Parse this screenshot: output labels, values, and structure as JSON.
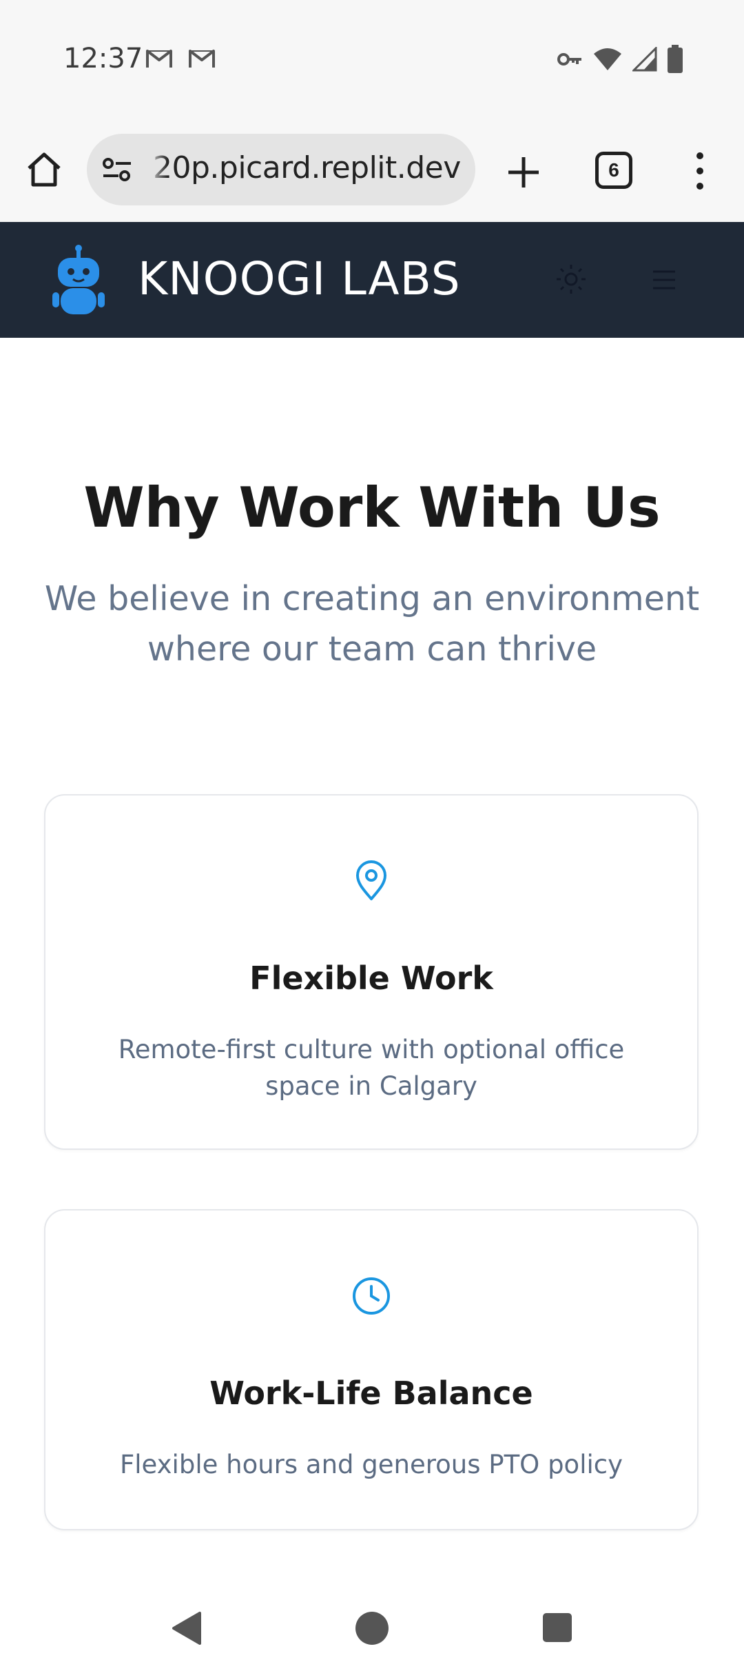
{
  "status_bar": {
    "time": "12:37",
    "left_icons": [
      "gmail-icon",
      "gmail-icon"
    ],
    "right_icons": [
      "vpn-key-icon",
      "wifi-icon",
      "cell-signal-icon",
      "battery-icon"
    ]
  },
  "browser": {
    "url": "20p.picard.replit.dev",
    "tab_count": "6",
    "icons": [
      "home-icon",
      "site-settings-icon",
      "plus-icon",
      "more-vert-icon"
    ]
  },
  "header": {
    "brand": "KNOOGI LABS",
    "brand_color": "#1f2937",
    "logo_color": "#2b8fe8"
  },
  "main": {
    "title": "Why Work With Us",
    "subtitle": "We believe in creating an environment where our team can thrive",
    "cards": [
      {
        "icon": "map-pin-icon",
        "title": "Flexible Work",
        "text": "Remote-first culture with optional office space in Calgary"
      },
      {
        "icon": "clock-icon",
        "title": "Work-Life Balance",
        "text": "Flexible hours and generous PTO policy"
      }
    ],
    "accent_color": "#1a96e0"
  },
  "nav_bar": {
    "icons": [
      "back-icon",
      "home-circle-icon",
      "recents-icon"
    ]
  }
}
